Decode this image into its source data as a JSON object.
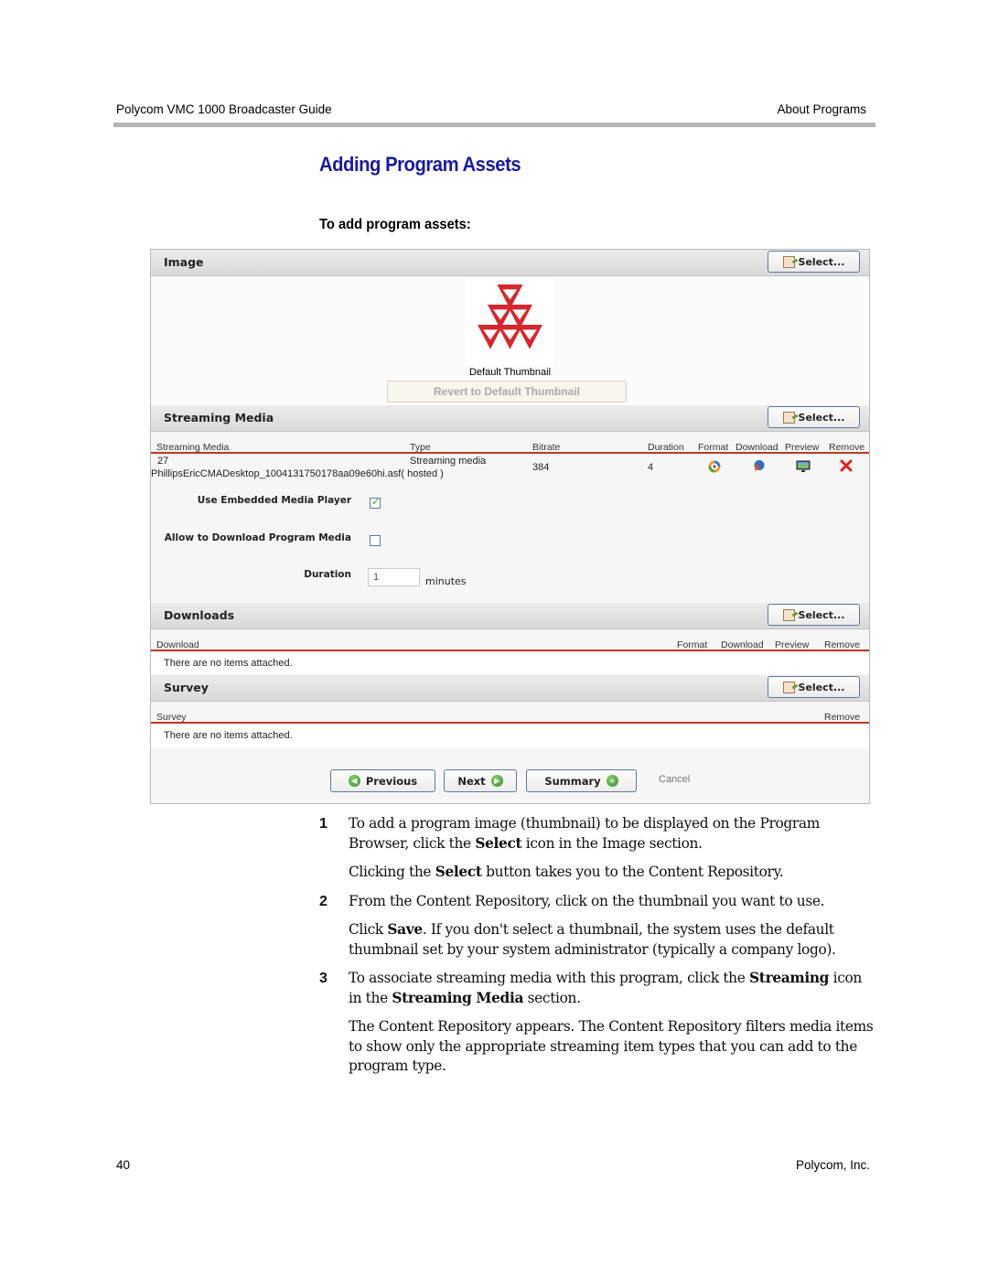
{
  "header": {
    "doc_title": "Polycom VMC 1000 Broadcaster Guide",
    "chapter": "About Programs"
  },
  "section_title": "Adding Program Assets",
  "procedure_title": "To add program assets:",
  "ui": {
    "image_section": {
      "title": "Image",
      "select_label": "Select...",
      "thumbnail_caption": "Default Thumbnail",
      "revert_label": "Revert to Default Thumbnail",
      "logo_color": "#d7262e"
    },
    "streaming_section": {
      "title": "Streaming Media",
      "select_label": "Select...",
      "columns": [
        "Streaming Media",
        "Type",
        "Bitrate",
        "Duration",
        "Format",
        "Download",
        "Preview",
        "Remove"
      ],
      "rows": [
        {
          "id": "27",
          "name": "PhillipsEricCMADesktop_1004131750178aa09e60hi.asf",
          "type": "Streaming media",
          "hosting": "( hosted )",
          "bitrate": "384",
          "duration": "4",
          "icons": [
            "format-icon",
            "download-icon",
            "preview-icon",
            "remove-icon"
          ]
        }
      ],
      "embedded_player_label": "Use Embedded Media Player",
      "embedded_player_checked": true,
      "allow_download_label": "Allow to Download Program Media",
      "allow_download_checked": false,
      "duration_label": "Duration",
      "duration_value": "1",
      "duration_unit": "minutes"
    },
    "downloads_section": {
      "title": "Downloads",
      "select_label": "Select...",
      "columns": [
        "Download",
        "Format",
        "Download",
        "Preview",
        "Remove"
      ],
      "empty_message": "There are no items attached."
    },
    "survey_section": {
      "title": "Survey",
      "select_label": "Select...",
      "columns": [
        "Survey",
        "Remove"
      ],
      "empty_message": "There are no items attached."
    },
    "nav": {
      "previous": "Previous",
      "next": "Next",
      "summary": "Summary",
      "cancel": "Cancel"
    },
    "accent_rule_color": "#c0392b"
  },
  "steps": [
    {
      "number": "1",
      "paragraphs": [
        [
          "To add a program image (thumbnail) to be displayed on the Program Browser, click the ",
          "Select",
          " icon in the Image section."
        ],
        [
          "Clicking the ",
          "Select",
          " button takes you to the Content Repository."
        ]
      ]
    },
    {
      "number": "2",
      "paragraphs": [
        [
          "From the Content Repository, click on the thumbnail you want to use."
        ],
        [
          "Click ",
          "Save",
          ". If you don't select a thumbnail, the system uses the default thumbnail set by your system administrator (typically a company logo)."
        ]
      ]
    },
    {
      "number": "3",
      "paragraphs": [
        [
          "To associate streaming media with this program, click the ",
          "Streaming",
          " icon in the ",
          "Streaming Media",
          " section."
        ],
        [
          "The Content Repository appears. The Content Repository filters media items to show only the appropriate streaming item types that you can add to the program type."
        ]
      ]
    }
  ],
  "footer": {
    "page_number": "40",
    "company": "Polycom, Inc."
  }
}
